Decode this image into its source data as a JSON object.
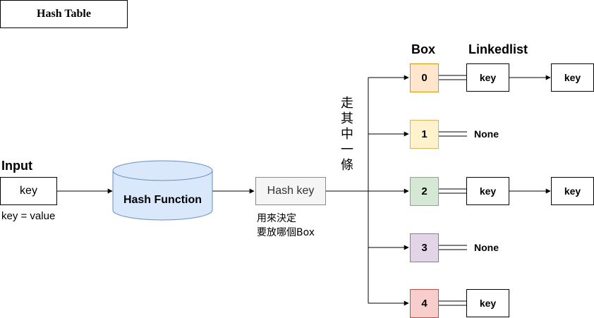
{
  "title": "Hash Table",
  "input": {
    "heading": "Input",
    "key": "key",
    "caption": "key = value"
  },
  "hash_function": {
    "label": "Hash Function"
  },
  "hash_key": {
    "label": "Hash key",
    "caption_line1": "用來決定",
    "caption_line2": "要放哪個Box"
  },
  "branch_text": [
    "走",
    "其",
    "中",
    "一",
    "條"
  ],
  "headers": {
    "box": "Box",
    "linkedlist": "Linkedlist"
  },
  "boxes": [
    {
      "label": "0",
      "fill": "#ffe6cc",
      "stroke": "#d79b00",
      "chain": [
        "key",
        "key"
      ]
    },
    {
      "label": "1",
      "fill": "#fff2cc",
      "stroke": "#d6b656",
      "chain": [],
      "none": "None"
    },
    {
      "label": "2",
      "fill": "#d5e8d4",
      "stroke": "#82b366",
      "chain": [
        "key",
        "key"
      ]
    },
    {
      "label": "3",
      "fill": "#e1d5e7",
      "stroke": "#9673a6",
      "chain": [],
      "none": "None"
    },
    {
      "label": "4",
      "fill": "#f8cecc",
      "stroke": "#b85450",
      "chain": [
        "key"
      ]
    }
  ],
  "colors": {
    "cylinder_fill": "#dae8fc",
    "cylinder_stroke": "#6c8ebf",
    "hash_key_fill": "#f5f5f5",
    "line": "#000000"
  }
}
